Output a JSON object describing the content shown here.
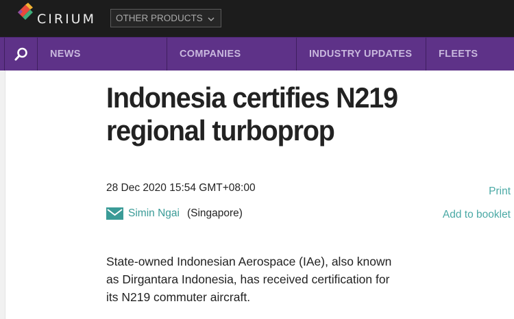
{
  "header": {
    "brand": "CIRIUM",
    "other_products": "OTHER PRODUCTS"
  },
  "nav": {
    "items": [
      {
        "label": "NEWS"
      },
      {
        "label": "COMPANIES"
      },
      {
        "label": "INDUSTRY UPDATES"
      },
      {
        "label": "FLEETS"
      }
    ]
  },
  "article": {
    "title_line1": "Indonesia certifies N219",
    "title_line2": "regional turboprop",
    "date": "28 Dec 2020 15:54 GMT+08:00",
    "author": "Simin Ngai",
    "location": "(Singapore)",
    "body_line1": "State-owned Indonesian Aerospace (IAe), also known",
    "body_line2": "as Dirgantara Indonesia, has received certification for",
    "body_line3": "its N219 commuter aircraft."
  },
  "actions": {
    "print": "Print",
    "add_to_booklet": "Add to booklet"
  },
  "colors": {
    "topbar": "#1c1c1c",
    "nav": "#5e3288",
    "link": "#3a9b97"
  }
}
